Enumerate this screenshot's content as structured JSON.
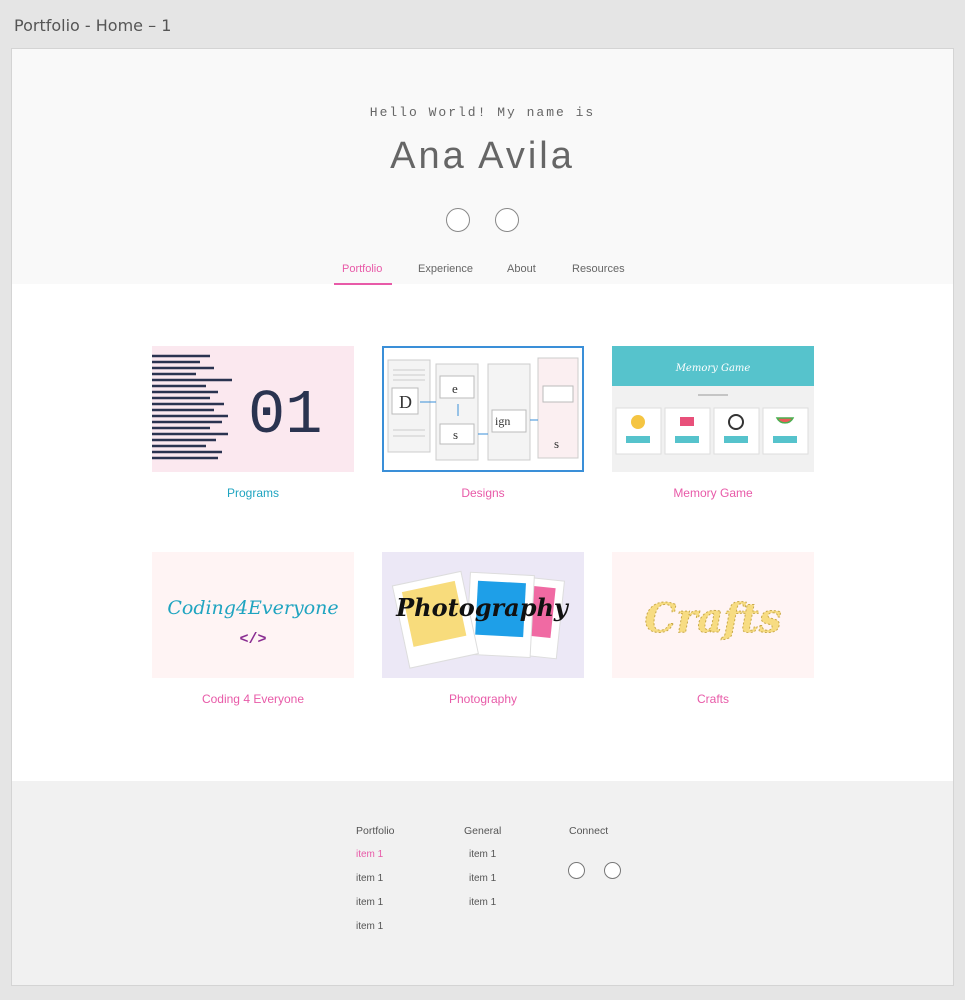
{
  "frame_title": "Portfolio - Home – 1",
  "hero": {
    "greeting": "Hello World! My name is",
    "name": "Ana Avila"
  },
  "tabs": [
    {
      "label": "Portfolio",
      "active": true
    },
    {
      "label": "Experience",
      "active": false
    },
    {
      "label": "About",
      "active": false
    },
    {
      "label": "Resources",
      "active": false
    }
  ],
  "cards": [
    {
      "label": "Programs",
      "thumb_text": "01"
    },
    {
      "label": "Designs",
      "thumb_letters": [
        "D",
        "e",
        "s",
        "ign",
        "s"
      ]
    },
    {
      "label": "Memory Game",
      "thumb_title": "Memory Game"
    },
    {
      "label": "Coding 4 Everyone",
      "thumb_text": "Coding4Everyone",
      "thumb_sub": "</>"
    },
    {
      "label": "Photography",
      "thumb_text": "Photography"
    },
    {
      "label": "Crafts",
      "thumb_text": "Crafts"
    }
  ],
  "footer": {
    "columns": [
      {
        "heading": "Portfolio",
        "items": [
          "item 1",
          "item 1",
          "item 1",
          "item 1"
        ]
      },
      {
        "heading": "General",
        "items": [
          "item 1",
          "item 1",
          "item 1"
        ]
      },
      {
        "heading": "Connect",
        "items": []
      }
    ]
  },
  "colors": {
    "accent_pink": "#e85aa8",
    "accent_teal": "#1fa4c0",
    "selection_blue": "#3a8fd8"
  }
}
